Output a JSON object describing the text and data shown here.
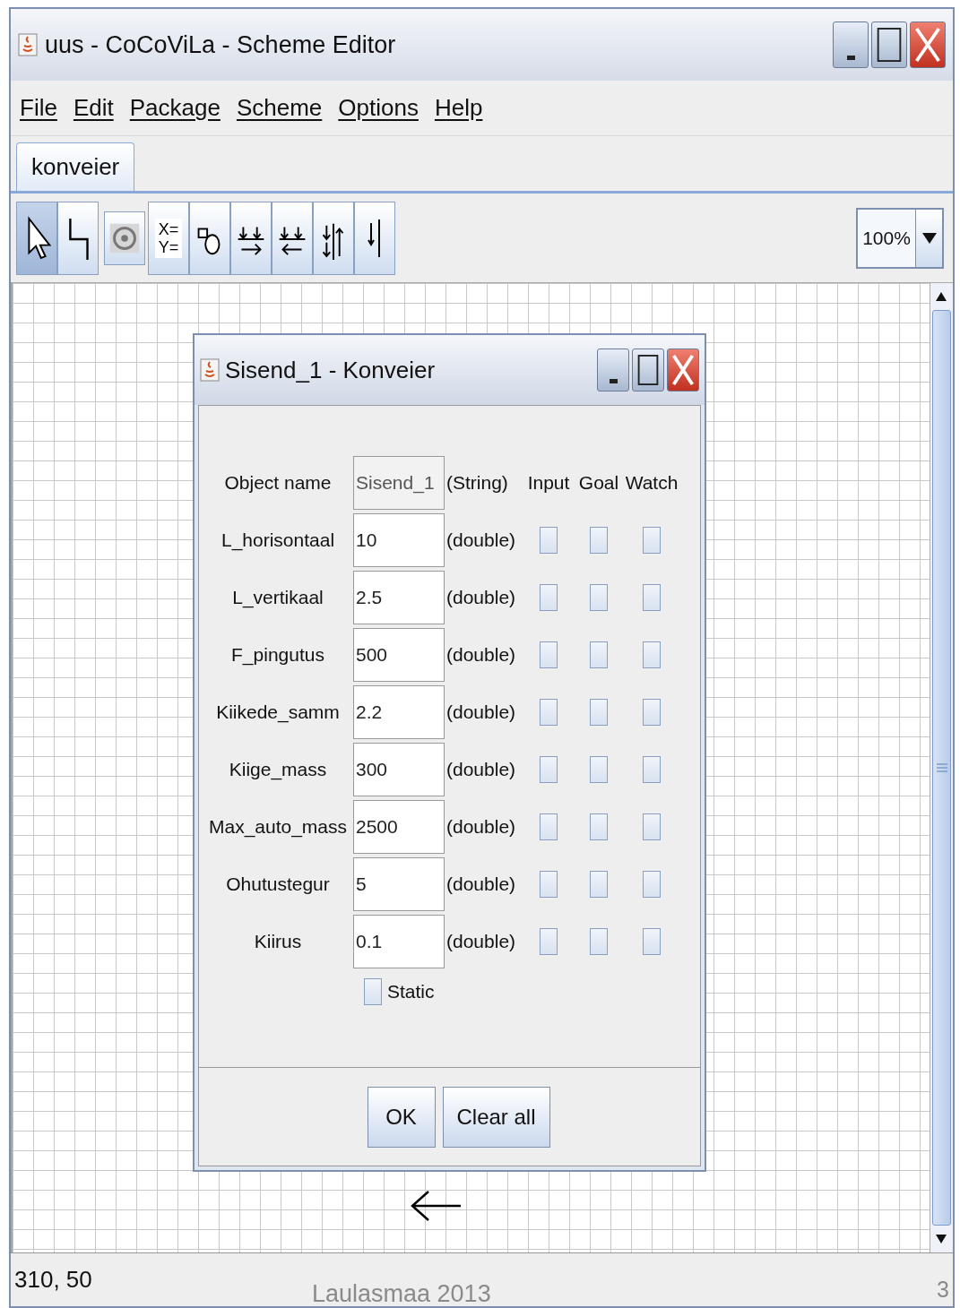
{
  "window": {
    "title": "uus - CoCoViLa - Scheme Editor"
  },
  "menu": [
    "File",
    "Edit",
    "Package",
    "Scheme",
    "Options",
    "Help"
  ],
  "tabs": [
    {
      "label": "konveier",
      "selected": true
    }
  ],
  "toolbar": {
    "tools": [
      {
        "kind": "pointer",
        "selected": true
      },
      {
        "kind": "relation",
        "selected": false
      },
      {
        "kind": "image",
        "selected": false
      },
      {
        "kind": "xy",
        "selected": false,
        "labels": [
          "X=",
          "Y="
        ]
      },
      {
        "kind": "shapes",
        "selected": false
      },
      {
        "kind": "arrow-right",
        "selected": false
      },
      {
        "kind": "arrow-left",
        "selected": false
      },
      {
        "kind": "down-up",
        "selected": false
      },
      {
        "kind": "down",
        "selected": false
      }
    ],
    "zoom": "100%"
  },
  "dialog": {
    "title": "Sisend_1 - Konveier",
    "header": {
      "label": "Object name",
      "value": "Sisend_1",
      "type": "(String)",
      "columns": [
        "Input",
        "Goal",
        "Watch"
      ]
    },
    "fields": [
      {
        "label": "L_horisontaal",
        "value": "10",
        "type": "(double)",
        "input": false,
        "goal": false,
        "watch": false
      },
      {
        "label": "L_vertikaal",
        "value": "2.5",
        "type": "(double)",
        "input": false,
        "goal": false,
        "watch": false
      },
      {
        "label": "F_pingutus",
        "value": "500",
        "type": "(double)",
        "input": false,
        "goal": false,
        "watch": false
      },
      {
        "label": "Kiikede_samm",
        "value": "2.2",
        "type": "(double)",
        "input": false,
        "goal": false,
        "watch": false
      },
      {
        "label": "Kiige_mass",
        "value": "300",
        "type": "(double)",
        "input": false,
        "goal": false,
        "watch": false
      },
      {
        "label": "Max_auto_mass",
        "value": "2500",
        "type": "(double)",
        "input": false,
        "goal": false,
        "watch": false
      },
      {
        "label": "Ohutustegur",
        "value": "5",
        "type": "(double)",
        "input": false,
        "goal": false,
        "watch": false
      },
      {
        "label": "Kiirus",
        "value": "0.1",
        "type": "(double)",
        "input": false,
        "goal": false,
        "watch": false
      }
    ],
    "static": {
      "label": "Static",
      "checked": false
    },
    "buttons": [
      "OK",
      "Clear all"
    ]
  },
  "status_bar": "310, 50",
  "slide_footer": {
    "text": "Laulasmaa 2013",
    "page": "3"
  }
}
